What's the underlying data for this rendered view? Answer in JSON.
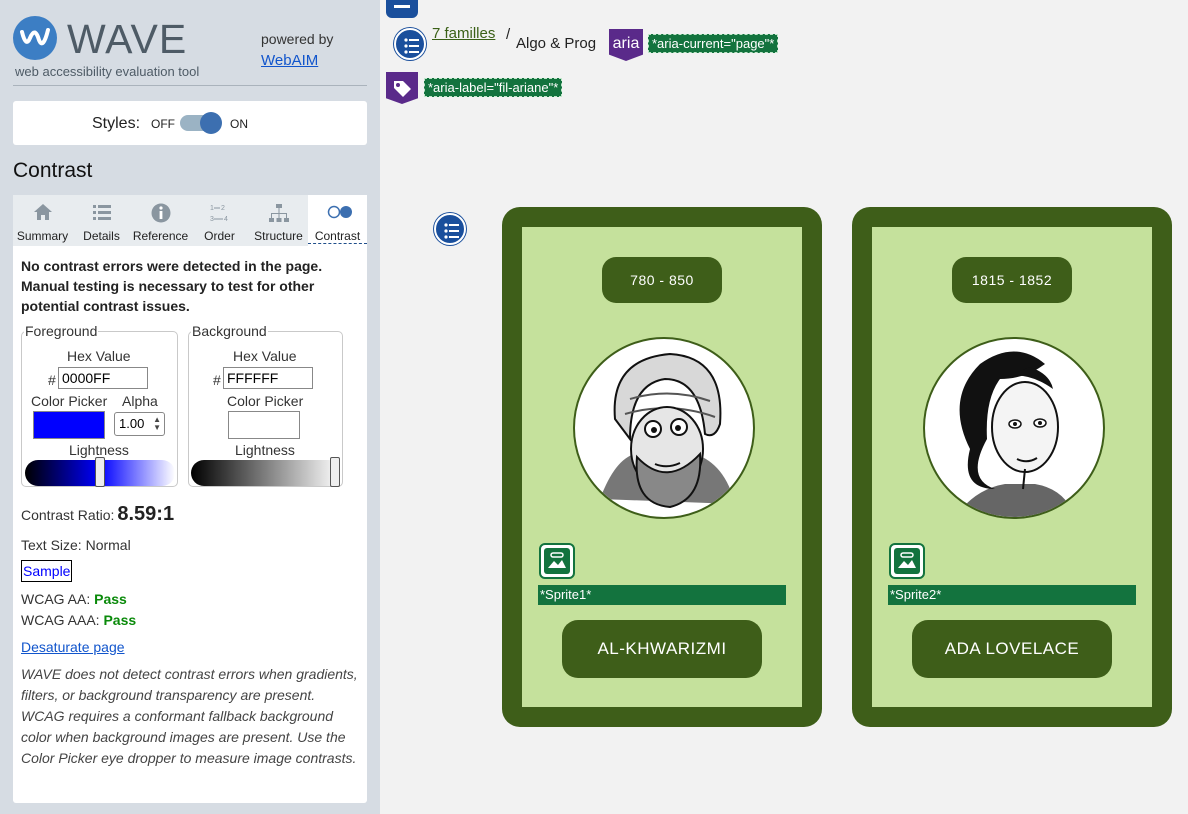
{
  "wave": {
    "logo_word": "WAVE",
    "logo_subtitle": "web accessibility evaluation tool",
    "powered_by": "powered by",
    "webaim_link": "WebAIM",
    "styles_label": "Styles:",
    "styles_off": "OFF",
    "styles_on": "ON",
    "section_title": "Contrast",
    "tabs": [
      {
        "label": "Summary",
        "icon": "home-icon"
      },
      {
        "label": "Details",
        "icon": "list-icon"
      },
      {
        "label": "Reference",
        "icon": "info-icon"
      },
      {
        "label": "Order",
        "icon": "order-icon"
      },
      {
        "label": "Structure",
        "icon": "structure-icon"
      },
      {
        "label": "Contrast",
        "icon": "contrast-icon",
        "active": true
      }
    ],
    "message": "No contrast errors were detected in the page. Manual testing is necessary to test for other potential contrast issues.",
    "foreground": {
      "legend": "Foreground",
      "hex_label": "Hex Value",
      "hash": "#",
      "hex_value": "0000FF",
      "picker_label": "Color Picker",
      "alpha_label": "Alpha",
      "alpha_value": "1.00",
      "lightness_label": "Lightness",
      "lightness": 0.5,
      "color": "#0000ff"
    },
    "background": {
      "legend": "Background",
      "hex_label": "Hex Value",
      "hash": "#",
      "hex_value": "FFFFFF",
      "picker_label": "Color Picker",
      "lightness_label": "Lightness",
      "lightness": 1.0,
      "color": "#ffffff"
    },
    "contrast_ratio_label": "Contrast Ratio:",
    "contrast_ratio": "8.59:1",
    "text_size": "Text Size: Normal",
    "sample": "Sample",
    "wcag_aa_label": "WCAG AA:",
    "wcag_aa_result": "Pass",
    "wcag_aaa_label": "WCAG AAA:",
    "wcag_aaa_result": "Pass",
    "desaturate_link": "Desaturate page",
    "note": "WAVE does not detect contrast errors when gradients, filters, or background transparency are present. WCAG requires a conformant fallback background color when background images are present. Use the Color Picker eye dropper to measure image contrasts."
  },
  "page": {
    "breadcrumb_link": "7 familles",
    "breadcrumb_sep": "/",
    "breadcrumb_current": "Algo & Prog",
    "aria_badge": "aria",
    "aria_current_label": "*aria-current=\"page\"*",
    "aria_label_label": "*aria-label=\"fil-ariane\"*",
    "cards": [
      {
        "dates": "780 - 850",
        "sprite": "*Sprite1*",
        "name": "AL-KHWARIZMI"
      },
      {
        "dates": "1815 - 1852",
        "sprite": "*Sprite2*",
        "name": "ADA LOVELACE"
      }
    ],
    "colors": {
      "card_dark": "#3e5e19",
      "card_light": "#c5e19c",
      "wave_green": "#13733e",
      "aria_purple": "#5a2a8a"
    }
  }
}
